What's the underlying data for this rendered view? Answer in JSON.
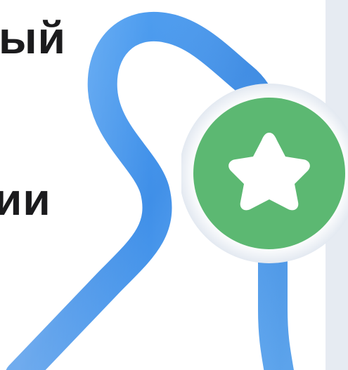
{
  "heading": {
    "line_1_fragment": "ый",
    "line_2_fragment": "ии"
  },
  "badge": {
    "icon": "star-icon",
    "color": "#5cb872",
    "ring_color": "#f3f6fa"
  },
  "route": {
    "color": "#4a9cf0"
  },
  "colors": {
    "text": "#1b1b1d",
    "side_panel": "#e6ebf2",
    "background": "#ffffff"
  }
}
